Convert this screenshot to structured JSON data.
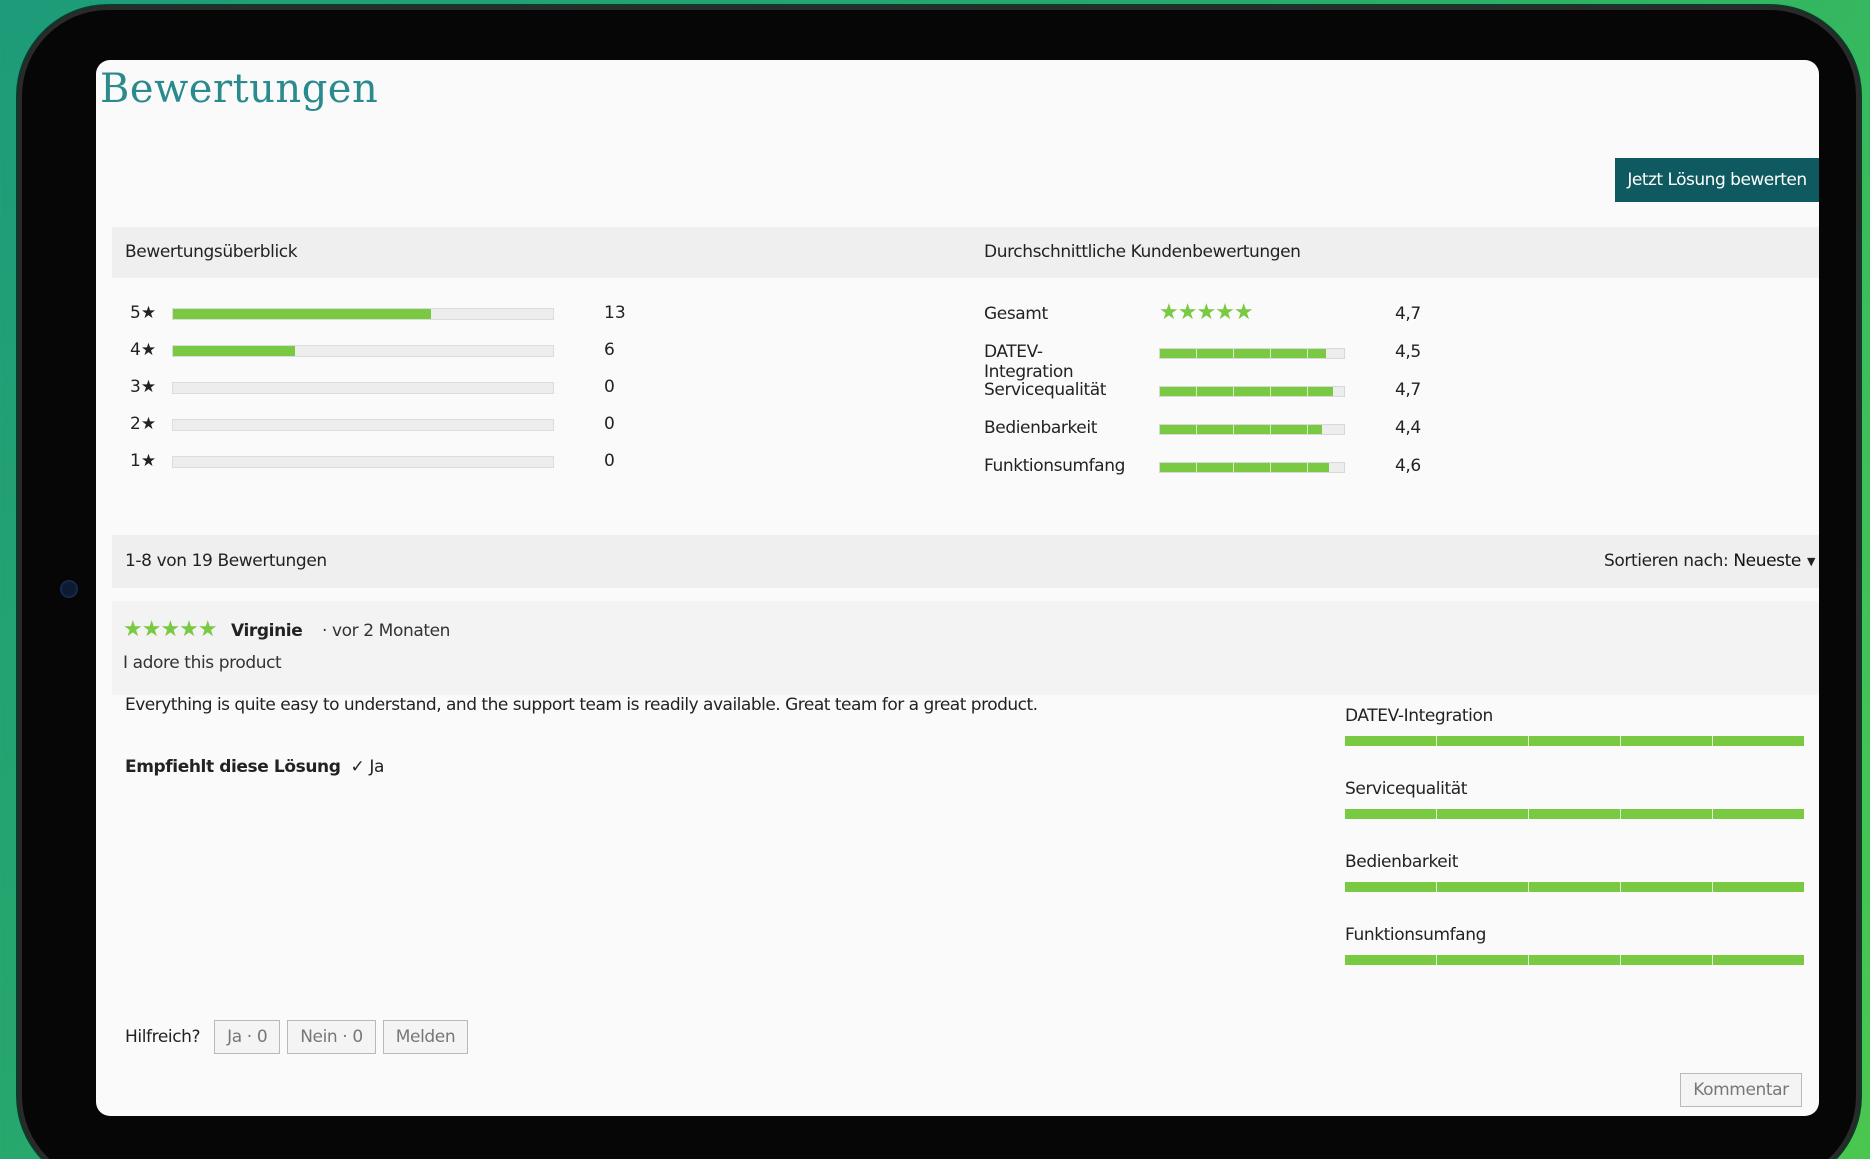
{
  "page": {
    "title": "Bewertungen",
    "cta": "Jetzt Lösung bewerten"
  },
  "overview": {
    "heading": "Bewertungsüberblick",
    "rows": [
      {
        "label": "5★",
        "count": "13",
        "share": 0.68
      },
      {
        "label": "4★",
        "count": "6",
        "share": 0.32
      },
      {
        "label": "3★",
        "count": "0",
        "share": 0
      },
      {
        "label": "2★",
        "count": "0",
        "share": 0
      },
      {
        "label": "1★",
        "count": "0",
        "share": 0
      }
    ]
  },
  "averages": {
    "heading": "Durchschnittliche Kundenbewertungen",
    "overall": {
      "label": "Gesamt",
      "stars": "★★★★★",
      "value": "4,7"
    },
    "items": [
      {
        "label": "DATEV-Integration",
        "value": "4,5",
        "rating": 4.5
      },
      {
        "label": "Servicequalität",
        "value": "4,7",
        "rating": 4.7
      },
      {
        "label": "Bedienbarkeit",
        "value": "4,4",
        "rating": 4.4
      },
      {
        "label": "Funktionsumfang",
        "value": "4,6",
        "rating": 4.6
      }
    ],
    "max": 5
  },
  "list": {
    "count_text": "1-8 von 19 Bewertungen",
    "sort_label": "Sortieren nach:",
    "sort_value": "Neueste"
  },
  "review": {
    "stars": "★★★★★",
    "author": "Virginie",
    "age": "· vor 2 Monaten",
    "title": "I adore this product",
    "body": "Everything is quite easy to understand, and the support team is readily available. Great team for a great product.",
    "recommend_label": "Empfiehlt diese Lösung",
    "recommend_value": "✓ Ja",
    "sub_ratings": [
      {
        "label": "DATEV-Integration",
        "rating": 5
      },
      {
        "label": "Servicequalität",
        "rating": 5
      },
      {
        "label": "Bedienbarkeit",
        "rating": 5
      },
      {
        "label": "Funktionsumfang",
        "rating": 5
      }
    ],
    "helpful_label": "Hilfreich?",
    "yes_button": "Ja · 0",
    "no_button": "Nein · 0",
    "report_button": "Melden",
    "comment_button": "Kommentar"
  },
  "colors": {
    "accent": "#0f5a60",
    "title": "#2a8a8e",
    "rating": "#7ac943"
  }
}
